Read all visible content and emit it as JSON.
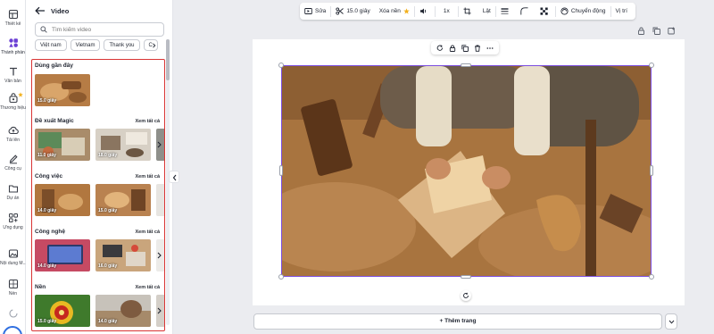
{
  "rail": {
    "items": [
      {
        "label": "Thiết kế",
        "icon": "layout-icon"
      },
      {
        "label": "Thành phần",
        "icon": "elements-icon"
      },
      {
        "label": "Văn bản",
        "icon": "text-icon"
      },
      {
        "label": "Thương hiệu",
        "icon": "brand-icon"
      },
      {
        "label": "Tải lên",
        "icon": "upload-icon"
      },
      {
        "label": "Công cụ",
        "icon": "draw-icon"
      },
      {
        "label": "Dự án",
        "icon": "folder-icon"
      },
      {
        "label": "Ứng dụng",
        "icon": "apps-icon"
      },
      {
        "label": "Nội dung M...",
        "icon": "photos-icon"
      },
      {
        "label": "Nền",
        "icon": "background-icon"
      }
    ]
  },
  "panel": {
    "title": "Video",
    "search_placeholder": "Tìm kiếm video",
    "chips": [
      "Việt nam",
      "Vietnam",
      "Thank you",
      "C"
    ],
    "sections": [
      {
        "title": "Dùng gần đây",
        "more": "",
        "thumbs": [
          "15.0 giây"
        ]
      },
      {
        "title": "Đề xuất Magic",
        "more": "Xem tất cả",
        "thumbs": [
          "11.0 giây",
          "18.0 giây"
        ]
      },
      {
        "title": "Công việc",
        "more": "Xem tất cả",
        "thumbs": [
          "14.0 giây",
          "15.0 giây"
        ]
      },
      {
        "title": "Công nghệ",
        "more": "Xem tất cả",
        "thumbs": [
          "14.0 giây",
          "16.0 giây"
        ]
      },
      {
        "title": "Nền",
        "more": "Xem tất cả",
        "thumbs": [
          "15.0 giây",
          "14.0 giây"
        ]
      }
    ]
  },
  "toolbar": {
    "edit": "Sửa",
    "duration": "15.0 giây",
    "remove_bg": "Xóa nền",
    "speed": "1x",
    "flip": "Lật",
    "animate": "Chuyển động",
    "position": "Vị trí"
  },
  "canvas": {
    "add_page": "+ Thêm trang"
  },
  "colors": {
    "accent": "#7b4ee0",
    "highlight_box": "#d93434",
    "premium_star": "#f2b01e"
  }
}
